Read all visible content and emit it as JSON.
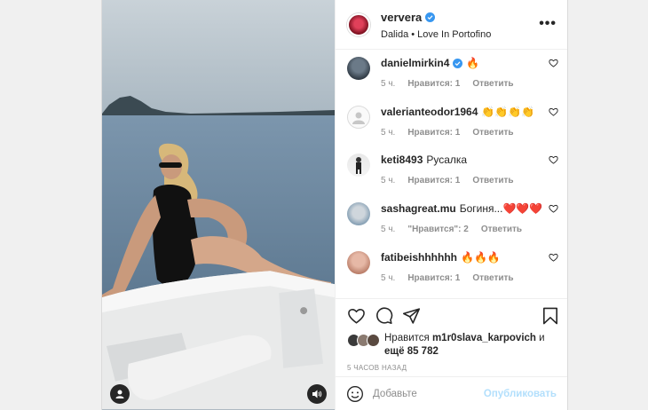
{
  "post": {
    "author": "ververa",
    "subtitle": "Dalida • Love In Portofino",
    "more": "•••"
  },
  "comments": [
    {
      "user": "danielmirkin4",
      "verified": true,
      "text": "🔥",
      "time": "5 ч.",
      "likes": "Нравится: 1",
      "reply": "Ответить"
    },
    {
      "user": "valerianteodor1964",
      "verified": false,
      "text": "👏👏👏👏",
      "time": "5 ч.",
      "likes": "Нравится: 1",
      "reply": "Ответить"
    },
    {
      "user": "keti8493",
      "verified": false,
      "text": "Русалка",
      "time": "5 ч.",
      "likes": "Нравится: 1",
      "reply": "Ответить"
    },
    {
      "user": "sashagreat.mu",
      "verified": false,
      "text": "Богиня...❤️❤️❤️",
      "time": "5 ч.",
      "likes": "\"Нравится\": 2",
      "reply": "Ответить"
    },
    {
      "user": "fatibeishhhhhh",
      "verified": false,
      "text": "🔥🔥🔥",
      "time": "5 ч.",
      "likes": "Нравится: 1",
      "reply": "Ответить"
    }
  ],
  "likes": {
    "prefix": "Нравится",
    "user": "m1r0slava_karpovich",
    "middle": "и",
    "others": "ещё 85 782"
  },
  "time_ago": "5 ЧАСОВ НАЗАД",
  "add_comment": {
    "placeholder": "Добавьте",
    "publish": "Опубликовать"
  },
  "colors": {
    "verified": "#3897f0",
    "publish_disabled": "#b2dffc",
    "muted": "#8e8e8e"
  }
}
